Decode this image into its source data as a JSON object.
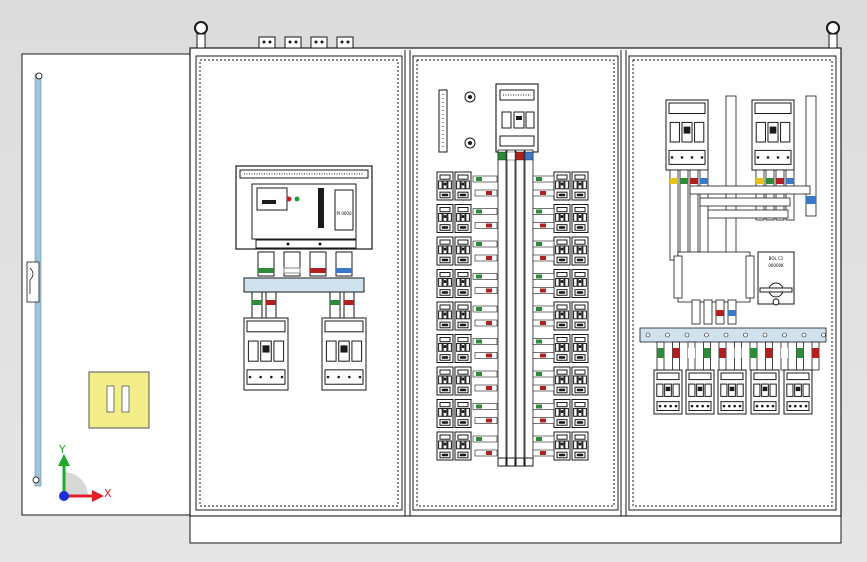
{
  "viewport": {
    "background": "#e2e2e2"
  },
  "triad": {
    "y_label": "Y",
    "x_label": "X",
    "colors": {
      "x": "#e0202a",
      "y": "#1faa2a",
      "origin": "#1c2ed8"
    }
  },
  "breaker_main": {
    "nameplate": "PI 0000"
  },
  "switch_disconnector": {
    "nameplate_line1": "BOL C1",
    "nameplate_line2": "00000K"
  },
  "colors": {
    "sheet_metal": "#ffffff",
    "outline": "#1a1a1a",
    "door_hinge_bar": "#9ec7dd",
    "vent_panel": "#f4ee8a",
    "busbar": "#cfe2ee",
    "phase_l1": "#2e8b3a",
    "phase_l2": "#ffffff",
    "phase_l3": "#b02020",
    "neutral": "#3a78c8",
    "yellow_phase": "#e6c21c"
  }
}
